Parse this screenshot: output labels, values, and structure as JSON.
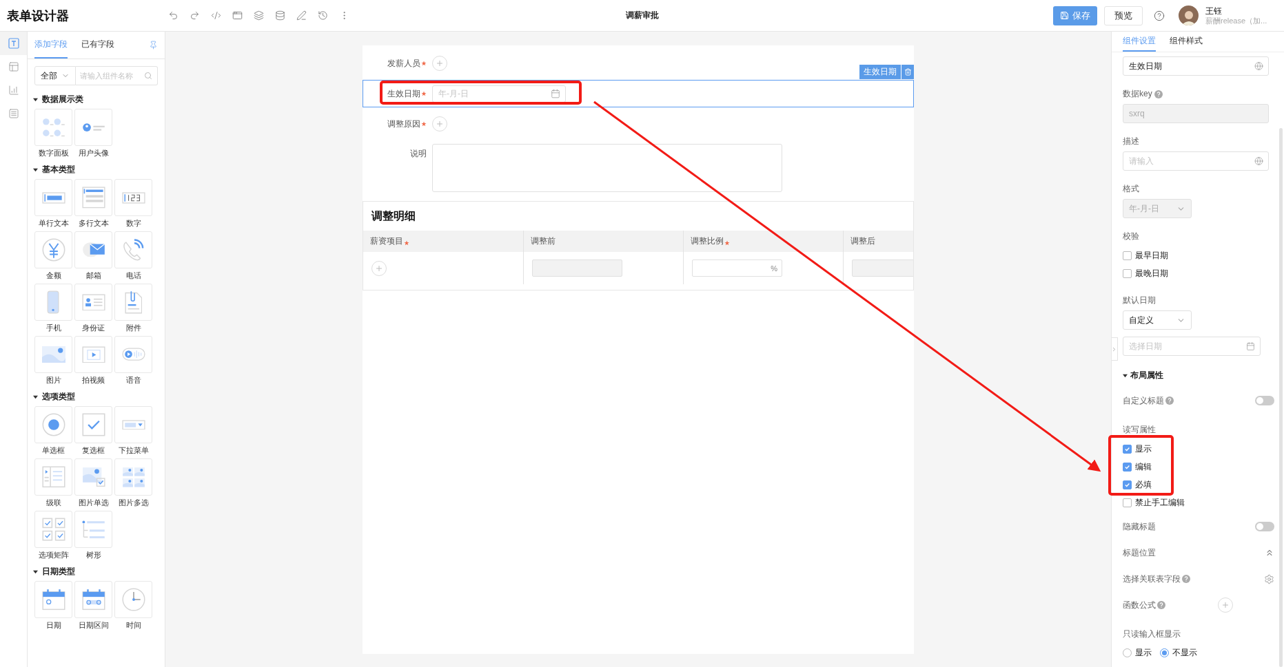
{
  "app": {
    "title": "表单设计器"
  },
  "toolbar": {
    "form_title": "调薪审批",
    "save": "保存",
    "preview": "预览"
  },
  "user": {
    "name": "王钰",
    "org": "薪酬release（加..."
  },
  "rail": [
    {
      "selected": true
    },
    {
      "selected": false
    },
    {
      "selected": false
    },
    {
      "selected": false
    }
  ],
  "palette": {
    "tabs": [
      {
        "label": "添加字段",
        "selected": true
      },
      {
        "label": "已有字段",
        "selected": false
      }
    ],
    "filter": "全部",
    "search_placeholder": "请输入组件名称",
    "groups": [
      {
        "title": "数据展示类",
        "expanded": true,
        "items": [
          "数字面板",
          "用户头像"
        ]
      },
      {
        "title": "基本类型",
        "expanded": true,
        "items": [
          "单行文本",
          "多行文本",
          "数字",
          "金额",
          "邮箱",
          "电话",
          "手机",
          "身份证",
          "附件",
          "图片",
          "拍视频",
          "语音"
        ]
      },
      {
        "title": "选项类型",
        "expanded": true,
        "items": [
          "单选框",
          "复选框",
          "下拉菜单",
          "级联",
          "图片单选",
          "图片多选",
          "选项矩阵",
          "树形"
        ]
      },
      {
        "title": "日期类型",
        "expanded": true,
        "items": [
          "日期",
          "日期区间",
          "时间"
        ]
      }
    ]
  },
  "form": {
    "fields": [
      {
        "label": "发薪人员",
        "required": true,
        "kind": "add",
        "selected": false
      },
      {
        "label": "生效日期",
        "required": true,
        "kind": "date",
        "placeholder": "年-月-日",
        "selected": true
      },
      {
        "label": "调整原因",
        "required": true,
        "kind": "add",
        "selected": false
      },
      {
        "label": "说明",
        "required": false,
        "kind": "textarea",
        "selected": false
      }
    ],
    "selection_badge": "生效日期",
    "subform": {
      "title": "调整明细",
      "columns": [
        {
          "label": "薪资项目",
          "required": true,
          "kind": "add"
        },
        {
          "label": "调整前",
          "required": false,
          "kind": "readonly"
        },
        {
          "label": "调整比例",
          "required": true,
          "kind": "percent",
          "suffix": "%"
        },
        {
          "label": "调整后",
          "required": false,
          "kind": "readonly"
        }
      ]
    }
  },
  "settings": {
    "tabs": [
      {
        "label": "组件设置",
        "selected": true
      },
      {
        "label": "组件样式",
        "selected": false
      }
    ],
    "items": [
      {
        "kind": "i18n-input",
        "value": "生效日期"
      },
      {
        "kind": "label",
        "text": "数据key",
        "help": true
      },
      {
        "kind": "input",
        "value": "sxrq",
        "disabled": true
      },
      {
        "kind": "label",
        "text": "描述",
        "help": false
      },
      {
        "kind": "i18n-input",
        "placeholder": "请输入"
      },
      {
        "kind": "label",
        "text": "格式",
        "help": false
      },
      {
        "kind": "select",
        "value": "年-月-日",
        "disabled": true
      },
      {
        "kind": "label",
        "text": "校验",
        "help": false
      },
      {
        "kind": "checkbox",
        "label": "最早日期",
        "checked": false
      },
      {
        "kind": "checkbox",
        "label": "最晚日期",
        "checked": false
      },
      {
        "kind": "label",
        "text": "默认日期",
        "help": false
      },
      {
        "kind": "select",
        "value": "自定义",
        "disabled": false
      },
      {
        "kind": "date-input",
        "placeholder": "选择日期"
      },
      {
        "kind": "section",
        "text": "布局属性",
        "expanded": true
      },
      {
        "kind": "toggle",
        "label": "自定义标题",
        "help": true,
        "on": false
      },
      {
        "kind": "label",
        "text": "读写属性",
        "help": false
      },
      {
        "kind": "checkbox",
        "label": "显示",
        "checked": true
      },
      {
        "kind": "checkbox",
        "label": "编辑",
        "checked": true
      },
      {
        "kind": "checkbox",
        "label": "必填",
        "checked": true
      },
      {
        "kind": "checkbox",
        "label": "禁止手工编辑",
        "checked": false
      },
      {
        "kind": "toggle",
        "label": "隐藏标题",
        "help": false,
        "on": false
      },
      {
        "kind": "fold",
        "label": "标题位置"
      },
      {
        "kind": "gear",
        "label": "选择关联表字段",
        "help": true
      },
      {
        "kind": "add",
        "label": "函数公式",
        "help": true
      },
      {
        "kind": "label",
        "text": "只读输入框显示",
        "help": false
      },
      {
        "kind": "radios",
        "options": [
          {
            "label": "显示",
            "selected": false
          },
          {
            "label": "不显示",
            "selected": true
          }
        ]
      }
    ]
  }
}
